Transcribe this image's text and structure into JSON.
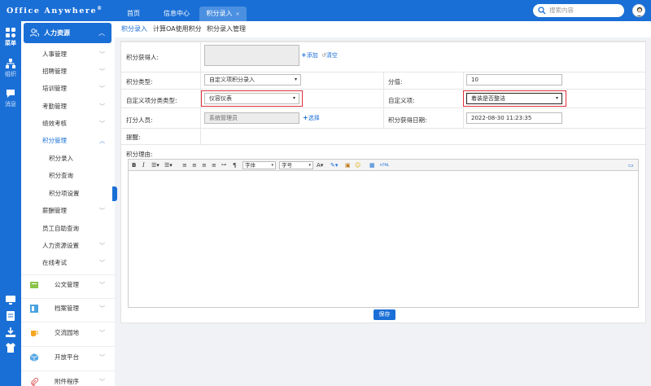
{
  "app": {
    "logo": "Office Anywhere",
    "logo_mark": "®"
  },
  "tabs": [
    {
      "label": "首页"
    },
    {
      "label": "信息中心"
    },
    {
      "label": "积分录入",
      "close": "×"
    }
  ],
  "search": {
    "placeholder": "搜索内容"
  },
  "rail": {
    "menu": "菜单",
    "org": "组织",
    "msg": "消息",
    "pill": "ON"
  },
  "sidebar": {
    "header": "人力资源",
    "items": [
      {
        "label": "人事管理"
      },
      {
        "label": "招聘管理"
      },
      {
        "label": "培训管理"
      },
      {
        "label": "考勤管理"
      },
      {
        "label": "绩效考核"
      },
      {
        "label": "积分管理"
      },
      {
        "label": "积分录入"
      },
      {
        "label": "积分查询"
      },
      {
        "label": "积分项设置"
      },
      {
        "label": "薪酬管理"
      },
      {
        "label": "员工自助查询"
      },
      {
        "label": "人力资源设置"
      },
      {
        "label": "在线考试"
      }
    ],
    "groups": [
      {
        "label": "公文管理"
      },
      {
        "label": "档案管理"
      },
      {
        "label": "交流园地"
      },
      {
        "label": "开放平台"
      },
      {
        "label": "附件程序"
      }
    ]
  },
  "breadcrumb": [
    "积分录入",
    "计算OA使用积分",
    "积分录入管理"
  ],
  "form": {
    "recipient_label": "积分获得人:",
    "add_link": "添加",
    "clear_link": "清空",
    "type_label": "积分类型:",
    "type_value": "自定义项积分录入",
    "score_label": "分值:",
    "score_value": "10",
    "custom_cat_label": "自定义项分类类型:",
    "custom_cat_value": "仪容仪表",
    "custom_item_label": "自定义项:",
    "custom_item_value": "着装是否整洁",
    "entered_by_label": "打分人员:",
    "entered_by_value": "系统管理员",
    "select_link": "选择",
    "date_label": "积分获得日期:",
    "date_value": "2022-08-30 11:23:35",
    "remind_label": "提醒:",
    "reason_label": "积分理由:",
    "font_select": "字体",
    "size_select": "字号",
    "save_label": "保存"
  },
  "colors": {
    "brand": "#1a6fd6",
    "highlight": "#e0303a"
  }
}
